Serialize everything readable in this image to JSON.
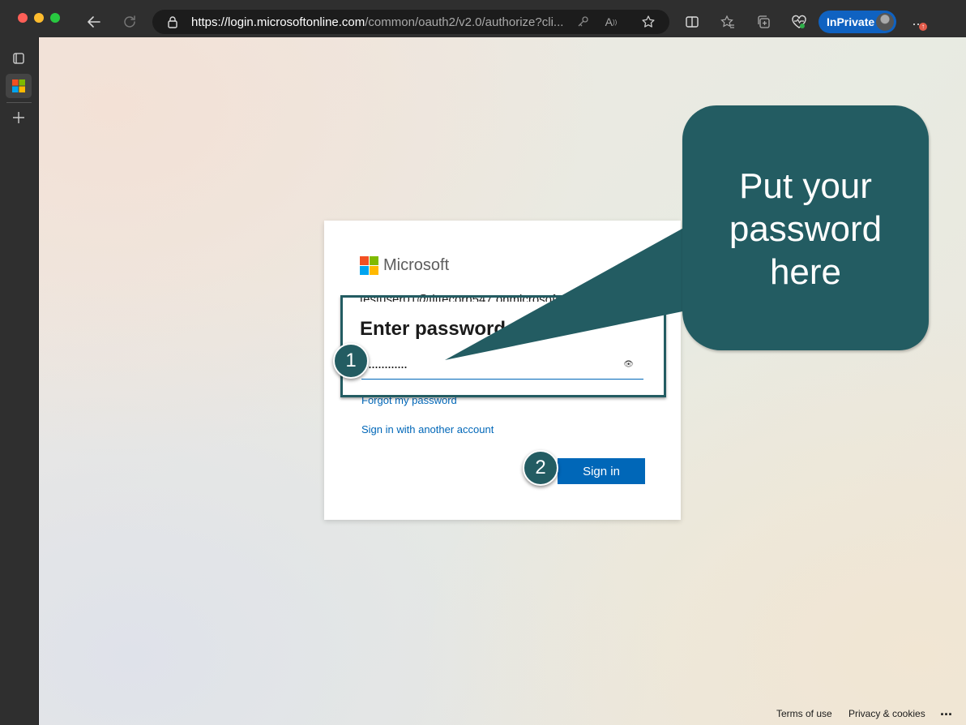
{
  "browser": {
    "url_domain": "https://login.microsoftonline.com",
    "url_rest": "/common/oauth2/v2.0/authorize?cli...",
    "inprivate_label": "InPrivate",
    "more_label": "..."
  },
  "login": {
    "brand": "Microsoft",
    "email": "testuser01@tittecorp547.onmicrosoft.com",
    "heading": "Enter password",
    "password_mask": "..............",
    "forgot_link": "Forgot my password",
    "other_account_link": "Sign in with another account",
    "signin_button": "Sign in"
  },
  "annotation": {
    "callout_line1": "Put your",
    "callout_line2": "password",
    "callout_line3": "here",
    "step1": "1",
    "step2": "2"
  },
  "footer": {
    "terms": "Terms of use",
    "privacy": "Privacy & cookies",
    "more": "..."
  },
  "colors": {
    "annotation_teal": "#235c62",
    "ms_blue": "#0067b8",
    "inprivate_blue": "#0f62c1"
  }
}
